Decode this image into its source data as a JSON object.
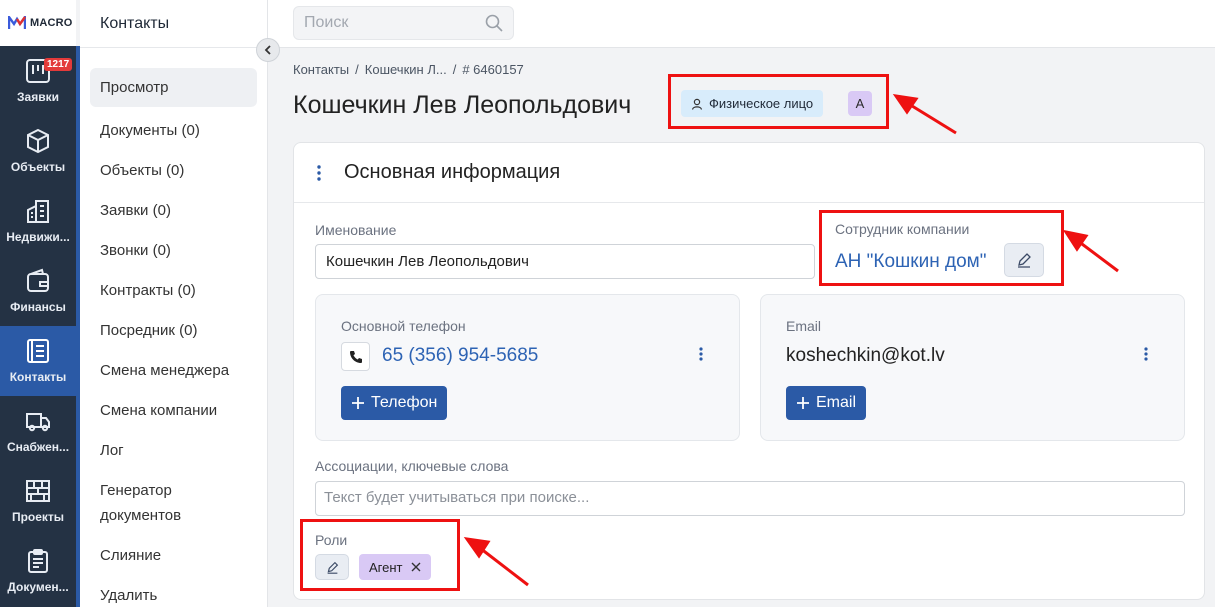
{
  "brand": {
    "logo_text": "MACRO"
  },
  "nav": {
    "items": [
      {
        "label": "Заявки",
        "badge": "1217",
        "icon": "requests-icon"
      },
      {
        "label": "Объекты",
        "icon": "cube-icon"
      },
      {
        "label": "Недвижи...",
        "icon": "buildings-icon"
      },
      {
        "label": "Финансы",
        "icon": "wallet-icon"
      },
      {
        "label": "Контакты",
        "icon": "contacts-icon",
        "active": true
      },
      {
        "label": "Снабжен...",
        "icon": "truck-icon"
      },
      {
        "label": "Проекты",
        "icon": "brick-wall-icon"
      },
      {
        "label": "Докумен...",
        "icon": "clipboard-icon"
      }
    ]
  },
  "submenu": {
    "title": "Контакты",
    "items": [
      "Просмотр",
      "Документы (0)",
      "Объекты (0)",
      "Заявки (0)",
      "Звонки (0)",
      "Контракты (0)",
      "Посредник (0)",
      "Смена менеджера",
      "Смена компании",
      "Лог",
      "Генератор документов",
      "Слияние",
      "Удалить"
    ]
  },
  "search": {
    "placeholder": "Поиск"
  },
  "breadcrumb": {
    "part1": "Контакты",
    "part2": "Кошечкин Л...",
    "part3": "# 6460157",
    "sep": "/"
  },
  "contact": {
    "title": "Кошечкин Лев Леопольдович",
    "type_chip": "Физическое лицо",
    "letter_chip": "А"
  },
  "card": {
    "title": "Основная информация",
    "name_label": "Именование",
    "name_value": "Кошечкин Лев Леопольдович",
    "employee_label": "Сотрудник компании",
    "employee_value": "АН \"Кошкин дом\"",
    "phone_label": "Основной телефон",
    "phone_value": "65 (356) 954-5685",
    "phone_add": "Телефон",
    "email_label": "Email",
    "email_value": "koshechkin@kot.lv",
    "email_add": "Email",
    "assoc_label": "Ассоциации, ключевые слова",
    "assoc_placeholder": "Текст будет учитываться при поиске...",
    "roles_label": "Роли",
    "role_chip": "Агент"
  },
  "colors": {
    "accent": "#2b5aa6",
    "nav_bg": "#243244",
    "annotation": "#ee1111",
    "badge": "#e33a3a"
  }
}
